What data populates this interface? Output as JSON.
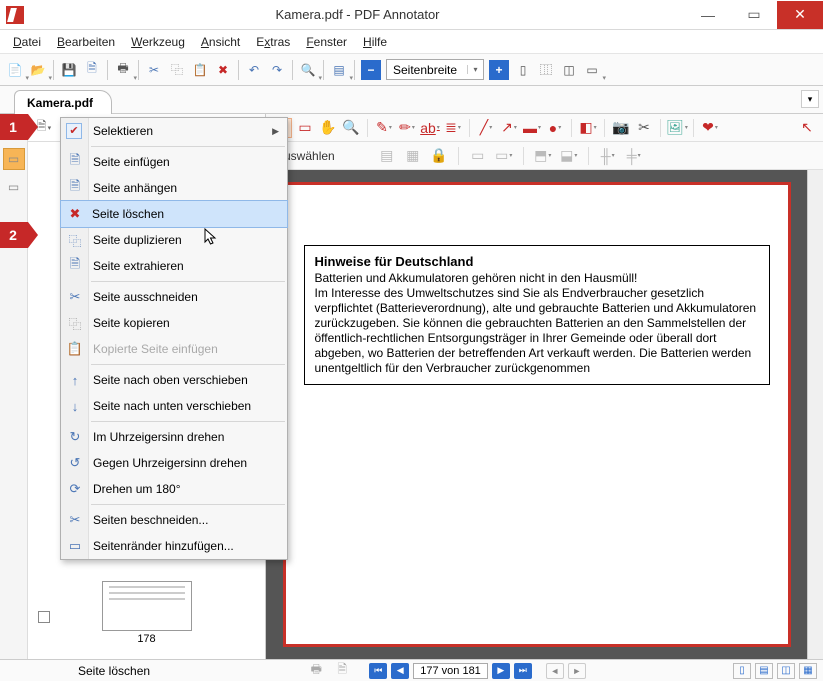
{
  "window": {
    "title": "Kamera.pdf - PDF Annotator"
  },
  "menubar": {
    "datei": "Datei",
    "bearbeiten": "Bearbeiten",
    "werkzeug": "Werkzeug",
    "ansicht": "Ansicht",
    "extras": "Extras",
    "fenster": "Fenster",
    "hilfe": "Hilfe"
  },
  "toolbar": {
    "zoom_value": "Seitenbreite"
  },
  "tab": {
    "name": "Kamera.pdf"
  },
  "dropdown": {
    "selektieren": "Selektieren",
    "einfuegen": "Seite einfügen",
    "anhaengen": "Seite anhängen",
    "loeschen": "Seite löschen",
    "duplizieren": "Seite duplizieren",
    "extrahieren": "Seite extrahieren",
    "ausschneiden": "Seite ausschneiden",
    "kopieren": "Seite kopieren",
    "paste": "Kopierte Seite einfügen",
    "oben": "Seite nach oben verschieben",
    "unten": "Seite nach unten verschieben",
    "uhrzeiger": "Im Uhrzeigersinn drehen",
    "gegen": "Gegen Uhrzeigersinn drehen",
    "d180": "Drehen um 180°",
    "beschneiden": "Seiten beschneiden...",
    "raender": "Seitenränder hinzufügen..."
  },
  "markers": {
    "m1": "1",
    "m2": "2"
  },
  "ann2": {
    "label": "Auswählen"
  },
  "doc": {
    "heading": "Hinweise für Deutschland",
    "p1": "Batterien und Akkumulatoren gehören nicht in den Hausmüll!",
    "p2": "Im Interesse des Umweltschutzes sind Sie als Endverbraucher gesetzlich verpflichtet (Batterieverordnung), alte und gebrauchte Batterien und Akkumulatoren zurückzugeben. Sie können die gebrauchten Batterien an den Sammelstellen der öffentlich-rechtlichen Entsorgungsträger in Ihrer Gemeinde oder überall dort abgeben, wo Batterien der betreffenden Art verkauft werden. Die Batterien werden unentgeltlich für den Verbraucher zurückgenommen"
  },
  "thumb": {
    "caption": "178"
  },
  "status": {
    "hint": "Seite löschen",
    "page": "177 von 181"
  }
}
